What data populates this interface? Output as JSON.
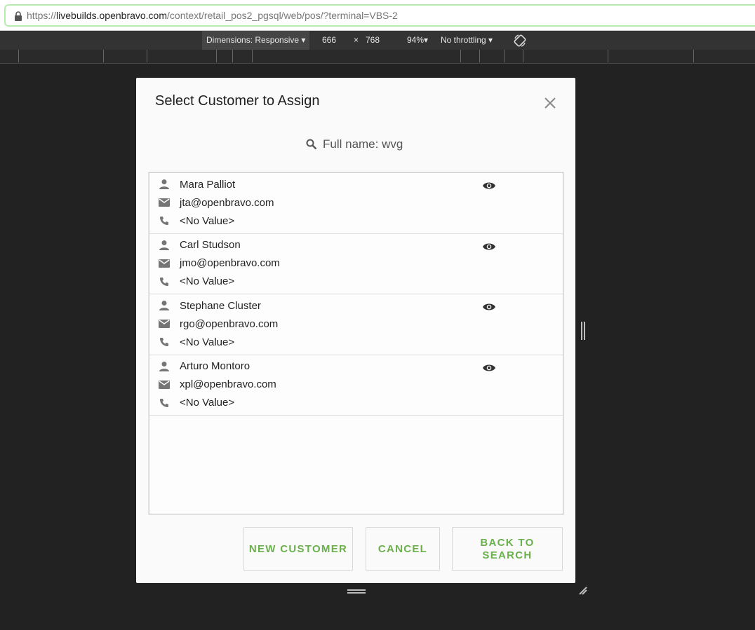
{
  "browser": {
    "url_prefix": "https://",
    "url_domain": "livebuilds.openbravo.com",
    "url_path": "/context/retail_pos2_pgsql/web/pos/?terminal=VBS-2"
  },
  "device_toolbar": {
    "dimensions": "Dimensions: Responsive",
    "width": "666",
    "times": "×",
    "height": "768",
    "zoom": "94%",
    "throttling": "No throttling"
  },
  "dialog": {
    "title": "Select Customer to Assign",
    "filter_text": "Full name: wvg",
    "customers": [
      {
        "name": "Mara Palliot",
        "email": "jta@openbravo.com",
        "phone": "<No Value>"
      },
      {
        "name": "Carl Studson",
        "email": "jmo@openbravo.com",
        "phone": "<No Value>"
      },
      {
        "name": "Stephane Cluster",
        "email": "rgo@openbravo.com",
        "phone": "<No Value>"
      },
      {
        "name": "Arturo Montoro",
        "email": "xpl@openbravo.com",
        "phone": "<No Value>"
      }
    ],
    "buttons": {
      "new_customer": "NEW CUSTOMER",
      "cancel": "CANCEL",
      "back_to_search": "BACK TO SEARCH"
    }
  },
  "colors": {
    "accent": "#6ab04c",
    "background": "#222222",
    "dialog": "#fafafa"
  }
}
